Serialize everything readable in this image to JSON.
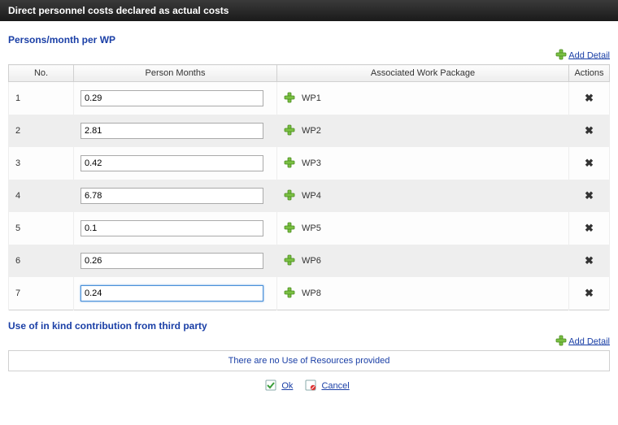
{
  "header": {
    "title": "Direct personnel costs declared as actual costs"
  },
  "section1": {
    "title": "Persons/month per WP",
    "add_detail": "Add Detail",
    "columns": {
      "no": "No.",
      "pm": "Person Months",
      "wp": "Associated Work Package",
      "actions": "Actions"
    },
    "rows": [
      {
        "no": "1",
        "pm": "0.29",
        "wp": "WP1"
      },
      {
        "no": "2",
        "pm": "2.81",
        "wp": "WP2"
      },
      {
        "no": "3",
        "pm": "0.42",
        "wp": "WP3"
      },
      {
        "no": "4",
        "pm": "6.78",
        "wp": "WP4"
      },
      {
        "no": "5",
        "pm": "0.1",
        "wp": "WP5"
      },
      {
        "no": "6",
        "pm": "0.26",
        "wp": "WP6"
      },
      {
        "no": "7",
        "pm": "0.24",
        "wp": "WP8"
      }
    ]
  },
  "section2": {
    "title": "Use of in kind contribution from third party",
    "add_detail": "Add Detail",
    "empty_text": "There are no Use of Resources provided"
  },
  "footer": {
    "ok": "Ok",
    "cancel": "Cancel"
  }
}
